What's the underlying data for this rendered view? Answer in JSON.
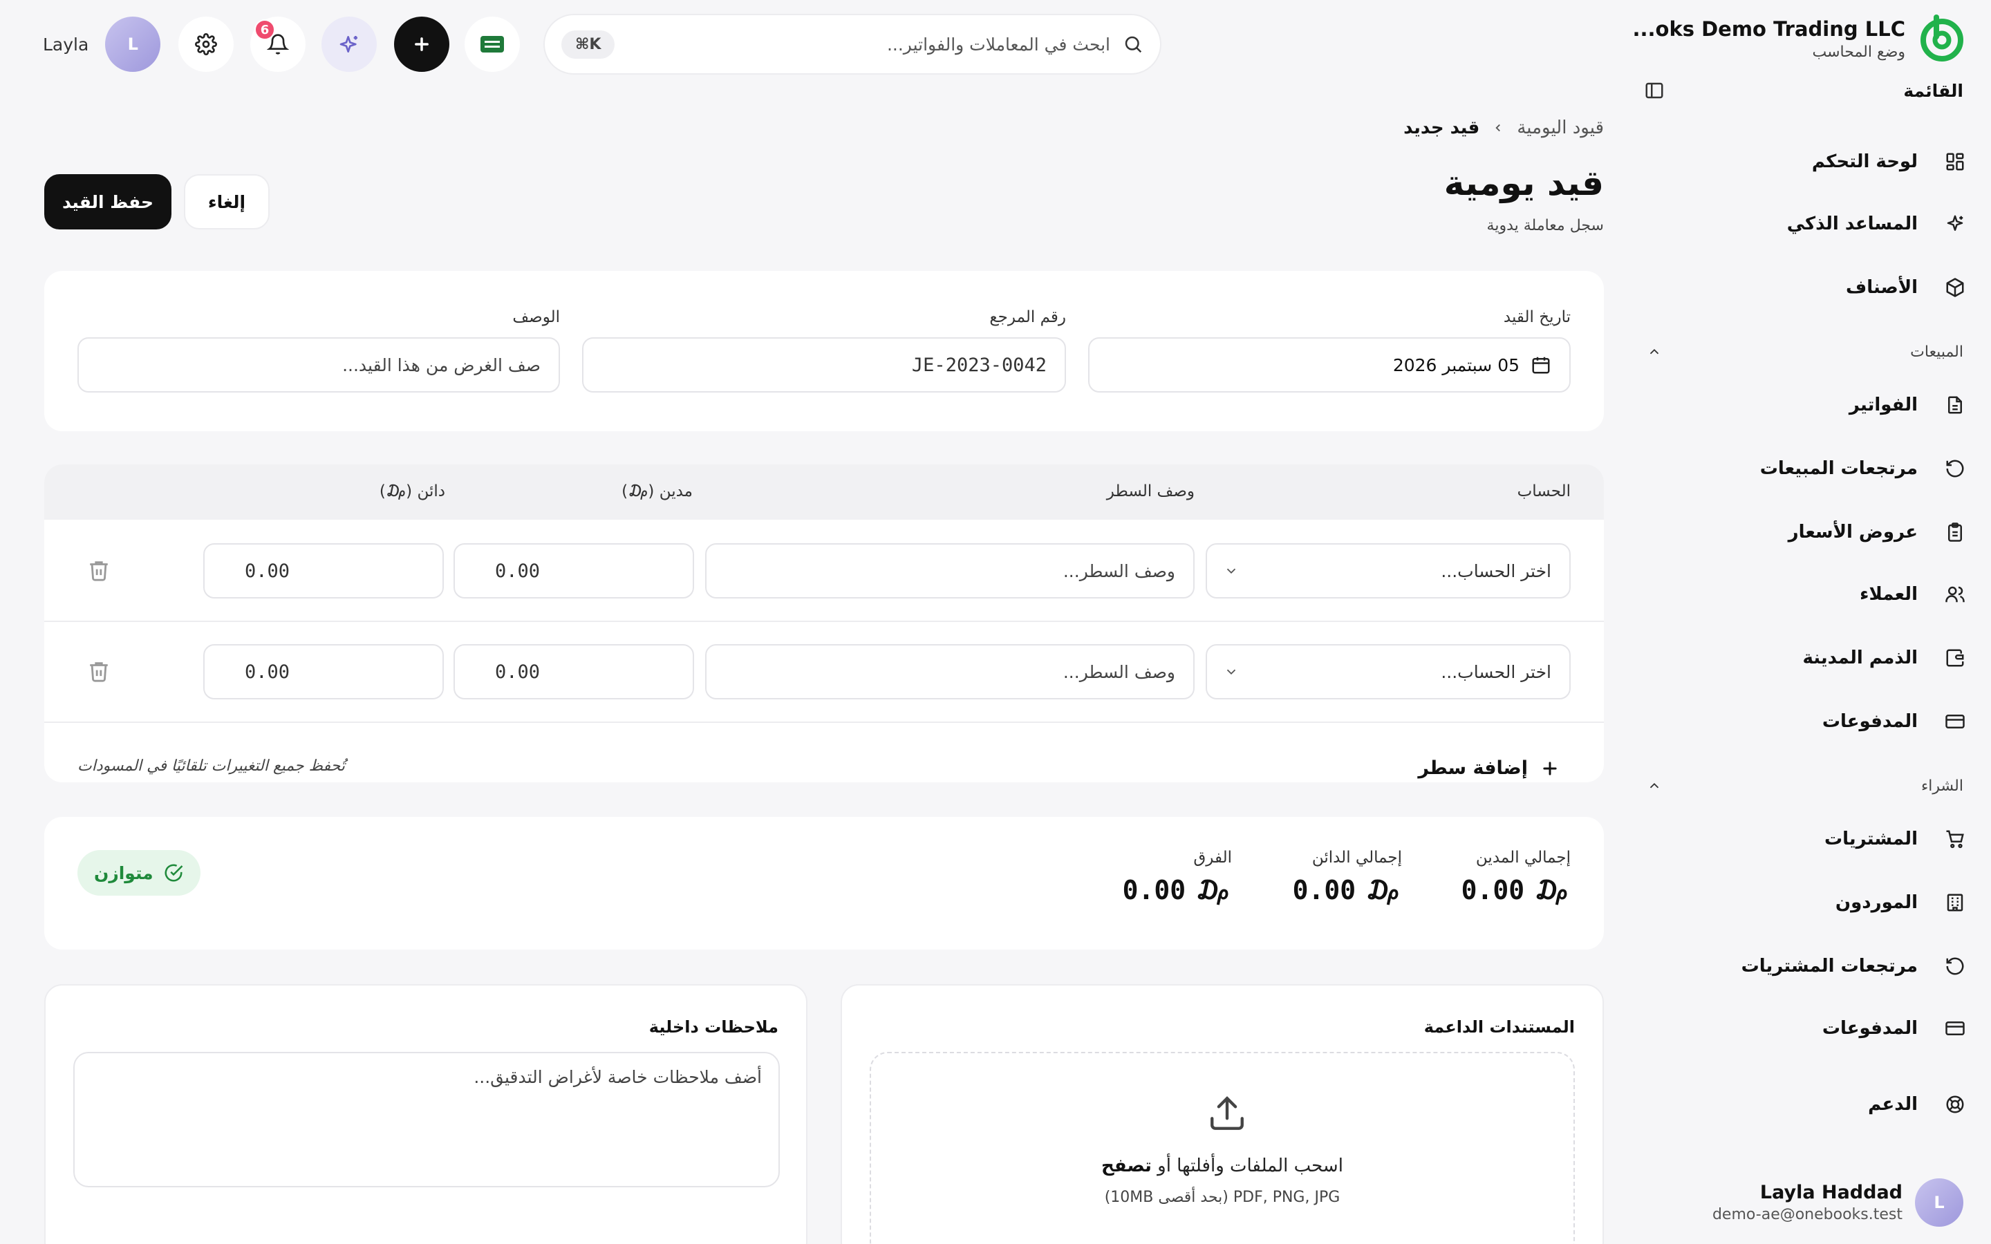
{
  "brand": {
    "name": "...oks Demo Trading LLC",
    "mode": "وضع المحاسب",
    "accent": "#21b24b"
  },
  "sidebar": {
    "menu_title": "القائمة",
    "items_top": [
      {
        "label": "لوحة التحكم",
        "icon": "grid-icon"
      },
      {
        "label": "المساعد الذكي",
        "icon": "sparkles-icon"
      },
      {
        "label": "الأصناف",
        "icon": "box-icon"
      }
    ],
    "sales": {
      "title": "المبيعات",
      "items": [
        {
          "label": "الفواتير",
          "icon": "file-icon"
        },
        {
          "label": "مرتجعات المبيعات",
          "icon": "undo-icon"
        },
        {
          "label": "عروض الأسعار",
          "icon": "clipboard-icon"
        },
        {
          "label": "العملاء",
          "icon": "users-icon"
        },
        {
          "label": "الذمم المدينة",
          "icon": "wallet-icon"
        },
        {
          "label": "المدفوعات",
          "icon": "card-icon"
        }
      ]
    },
    "purchases": {
      "title": "الشراء",
      "items": [
        {
          "label": "المشتريات",
          "icon": "cart-icon"
        },
        {
          "label": "الموردون",
          "icon": "building-icon"
        },
        {
          "label": "مرتجعات المشتريات",
          "icon": "undo-icon"
        },
        {
          "label": "المدفوعات",
          "icon": "card-icon"
        }
      ]
    },
    "support": {
      "label": "الدعم",
      "icon": "lifebuoy-icon"
    },
    "user": {
      "initial": "L",
      "name": "Layla Haddad",
      "email": "demo-ae@onebooks.test"
    }
  },
  "topbar": {
    "search_placeholder": "ابحث في المعاملات والفواتير...",
    "shortcut": "⌘K",
    "notifications_count": "6",
    "user_name": "Layla",
    "user_initial": "L"
  },
  "breadcrumb": {
    "parent": "قيود اليومية",
    "current": "قيد جديد"
  },
  "page": {
    "title": "قيد يومية",
    "subtitle": "سجل معاملة يدوية"
  },
  "actions": {
    "save": "حفظ القيد",
    "cancel": "إلغاء"
  },
  "form": {
    "date_label": "تاريخ القيد",
    "date_value": "05 سبتمبر 2026",
    "ref_label": "رقم المرجع",
    "ref_value": "JE-2023-0042",
    "desc_label": "الوصف",
    "desc_placeholder": "صف الغرض من هذا القيد..."
  },
  "lines": {
    "headers": {
      "account": "الحساب",
      "line_desc": "وصف السطر",
      "debit": "مدين (₯)",
      "credit": "دائن (₯)"
    },
    "rows": [
      {
        "account": "اختر الحساب...",
        "desc": "وصف السطر...",
        "debit": "0.00",
        "credit": "0.00"
      },
      {
        "account": "اختر الحساب...",
        "desc": "وصف السطر...",
        "debit": "0.00",
        "credit": "0.00"
      }
    ],
    "add_line": "إضافة سطر",
    "autosave_note": "تُحفظ جميع التغييرات تلقائيًا في المسودات"
  },
  "totals": {
    "debit_label": "إجمالي المدين",
    "debit_value": "0.00",
    "credit_label": "إجمالي الدائن",
    "credit_value": "0.00",
    "diff_label": "الفرق",
    "diff_value": "0.00",
    "status": "متوازن",
    "status_color": "#1f8a3b"
  },
  "attachments": {
    "title": "المستندات الداعمة",
    "drop_text": "اسحب الملفات وأفلتها أو",
    "browse": "تصفح",
    "formats": "PDF, PNG, JPG (بحد أقصى 10MB)"
  },
  "notes": {
    "title": "ملاحظات داخلية",
    "placeholder": "أضف ملاحظات خاصة لأغراض التدقيق..."
  }
}
